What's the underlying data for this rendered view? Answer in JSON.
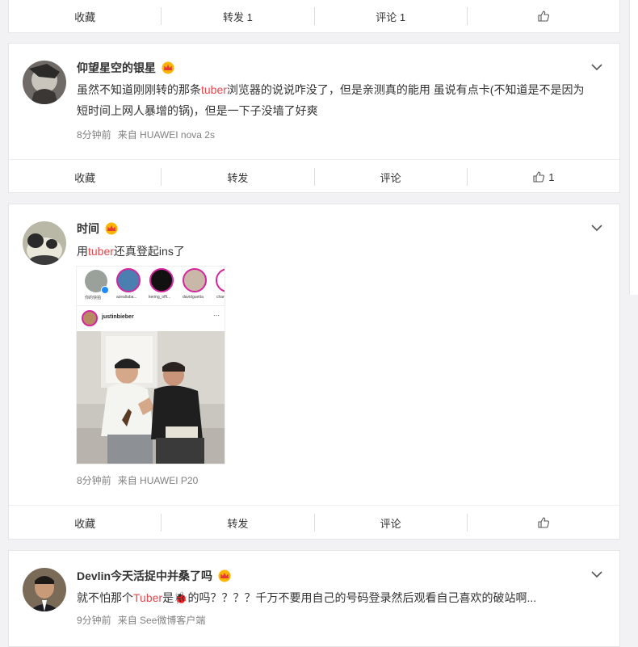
{
  "post0": {
    "actions": {
      "fav": "收藏",
      "repost": "转发 1",
      "comment": "评论 1",
      "like": ""
    }
  },
  "post1": {
    "name": "仰望星空的银星",
    "content_before": "虽然不知道刚刚转的那条",
    "highlight": "tuber",
    "content_after": "浏览器的说说咋没了，但是亲测真的能用 虽说有点卡(不知道是不是因为短时间上网人暴增的锅)，但是一下子没墙了好爽",
    "time": "8分钟前",
    "source": "来自 HUAWEI nova 2s",
    "actions": {
      "fav": "收藏",
      "repost": "转发",
      "comment": "评论",
      "like": "1"
    }
  },
  "post2": {
    "name": "时间",
    "content_before": "用",
    "highlight": "tuber",
    "content_after": "还真登起ins了",
    "image": {
      "stories": [
        "你的快拍",
        "azealiaba...",
        "kering_offi...",
        "davidguetta",
        "chan"
      ],
      "post_user": "justinbieber",
      "more": "···"
    },
    "time": "8分钟前",
    "source": "来自 HUAWEI P20",
    "actions": {
      "fav": "收藏",
      "repost": "转发",
      "comment": "评论",
      "like": ""
    }
  },
  "post3": {
    "name": "Devlin今天活捉中并桑了吗",
    "content_before": "就不怕那个",
    "highlight": "Tuber",
    "content_after": "是🐞的吗？？？？千万不要用自己的号码登录然后观看自己喜欢的破站啊...",
    "time": "9分钟前",
    "source": "来自 See微博客户端"
  }
}
